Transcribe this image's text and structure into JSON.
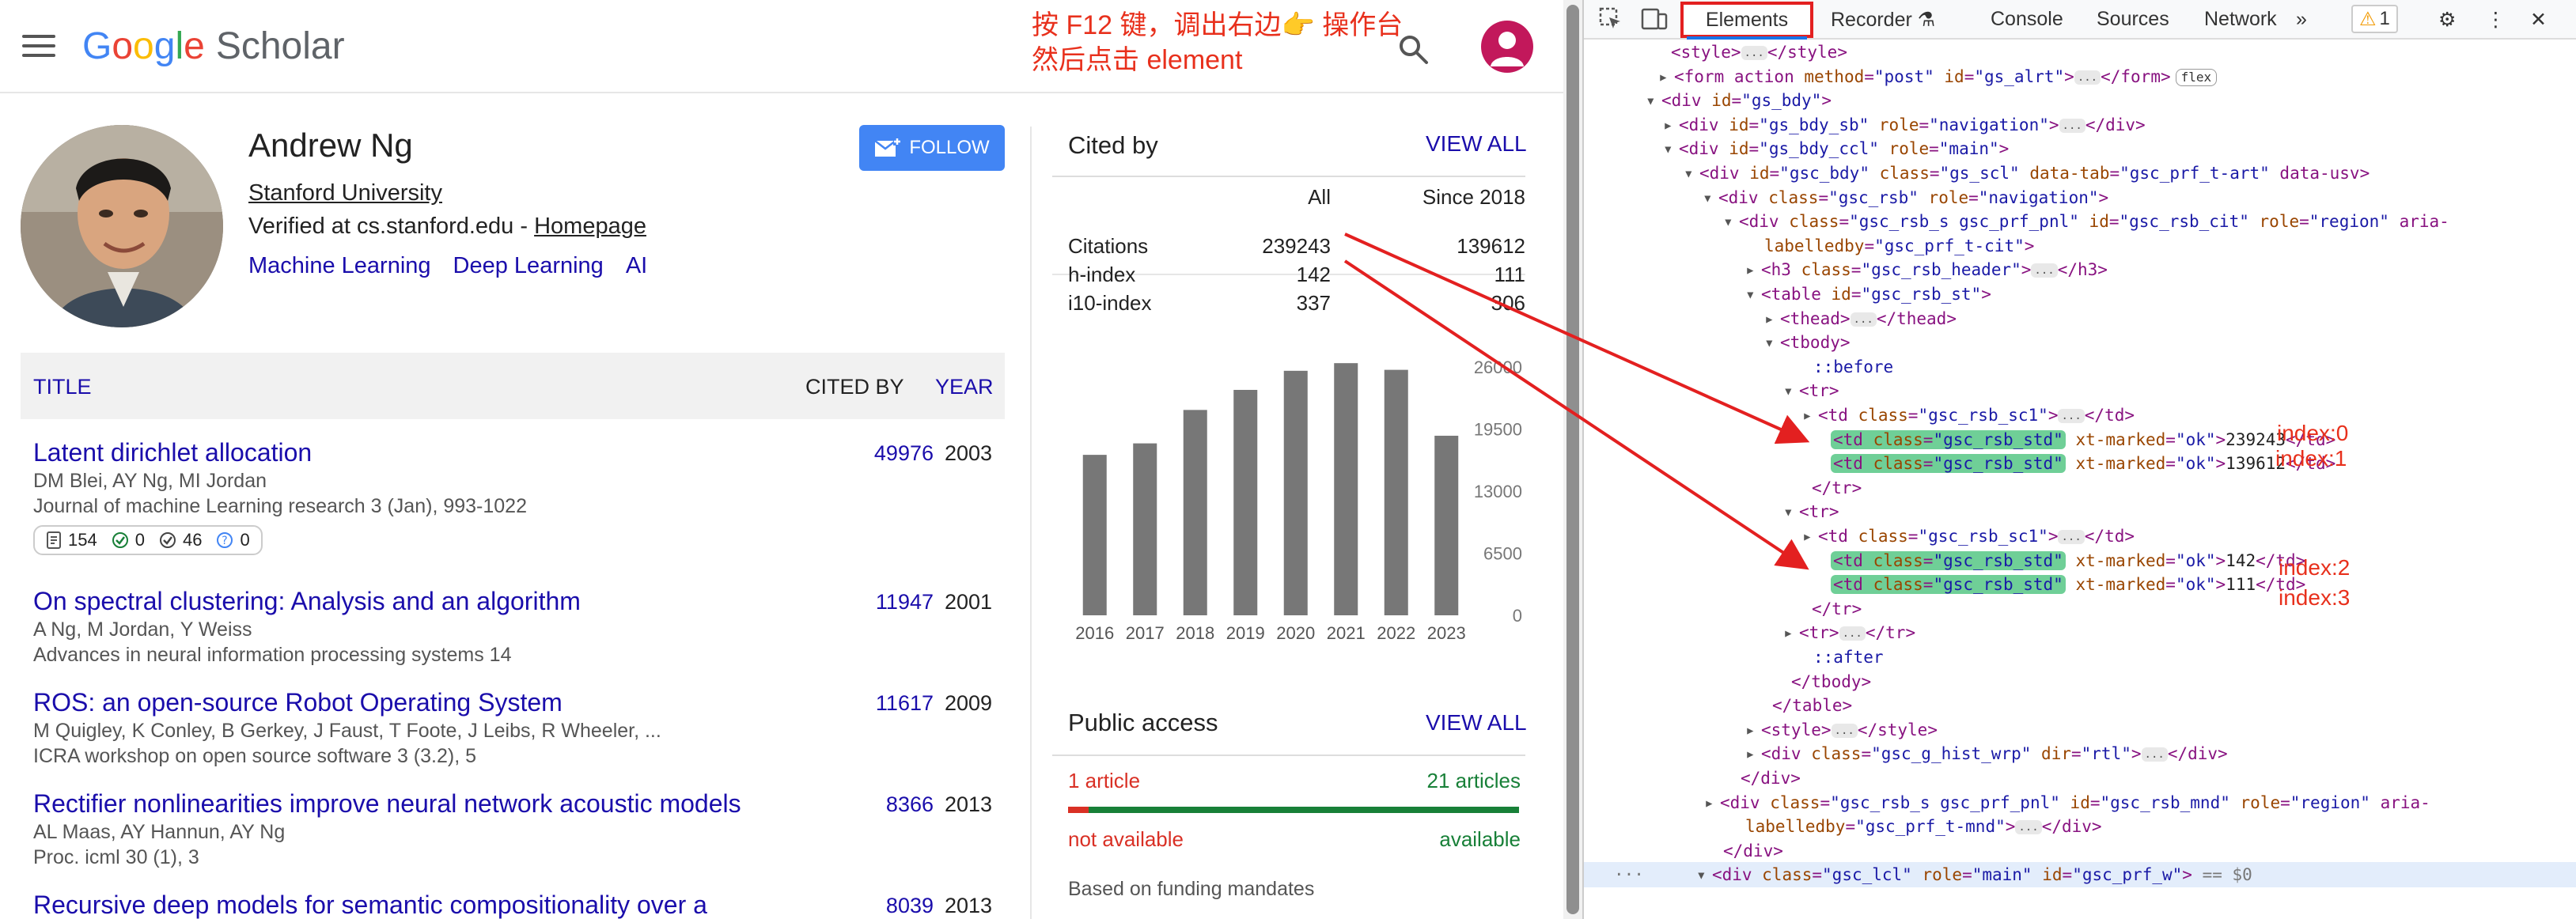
{
  "header": {
    "logo_google": [
      "G",
      "o",
      "o",
      "g",
      "l",
      "e"
    ],
    "logo_scholar": "Scholar",
    "note_line1": "按 F12 键，调出右边👉 操作台",
    "note_line2": "然后点击 element"
  },
  "profile": {
    "name": "Andrew Ng",
    "affiliation": "Stanford University",
    "verified": "Verified at cs.stanford.edu - ",
    "homepage": "Homepage",
    "interests": [
      "Machine Learning",
      "Deep Learning",
      "AI"
    ],
    "follow_label": "FOLLOW"
  },
  "articles": {
    "col_title": "TITLE",
    "col_cited": "CITED BY",
    "col_year": "YEAR",
    "items": [
      {
        "title": "Latent dirichlet allocation",
        "authors": "DM Blei, AY Ng, MI Jordan",
        "venue": "Journal of machine Learning research 3 (Jan), 993-1022",
        "cited": "49976",
        "year": "2003"
      },
      {
        "title": "On spectral clustering: Analysis and an algorithm",
        "authors": "A Ng, M Jordan, Y Weiss",
        "venue": "Advances in neural information processing systems 14",
        "cited": "11947",
        "year": "2001"
      },
      {
        "title": "ROS: an open-source Robot Operating System",
        "authors": "M Quigley, K Conley, B Gerkey, J Faust, T Foote, J Leibs, R Wheeler, ...",
        "venue": "ICRA workshop on open source software 3 (3.2), 5",
        "cited": "11617",
        "year": "2009"
      },
      {
        "title": "Rectifier nonlinearities improve neural network acoustic models",
        "authors": "AL Maas, AY Hannun, AY Ng",
        "venue": "Proc. icml 30 (1), 3",
        "cited": "8366",
        "year": "2013"
      },
      {
        "title": "Recursive deep models for semantic compositionality over a",
        "authors": "",
        "venue": "",
        "cited": "8039",
        "year": "2013"
      }
    ],
    "metrics": {
      "versions": "154",
      "free": "0",
      "checked": "46",
      "unknown": "0"
    }
  },
  "cited_by": {
    "title": "Cited by",
    "view_all": "VIEW ALL",
    "col_all": "All",
    "col_since": "Since 2018",
    "rows": [
      {
        "label": "Citations",
        "all": "239243",
        "since": "139612"
      },
      {
        "label": "h-index",
        "all": "142",
        "since": "111"
      },
      {
        "label": "i10-index",
        "all": "337",
        "since": "306"
      }
    ]
  },
  "chart_data": {
    "type": "bar",
    "categories": [
      "2016",
      "2017",
      "2018",
      "2019",
      "2020",
      "2021",
      "2022",
      "2023"
    ],
    "values": [
      16800,
      18000,
      21500,
      23600,
      25600,
      26400,
      25700,
      18800
    ],
    "ylim": [
      0,
      26000
    ],
    "yticks": [
      "26000",
      "19500",
      "13000",
      "6500",
      "0"
    ],
    "bar_color": "#777777"
  },
  "public_access": {
    "title": "Public access",
    "view_all": "VIEW ALL",
    "left_count": "1 article",
    "right_count": "21 articles",
    "fill_fraction": 0.045,
    "left_label": "not available",
    "right_label": "available",
    "footer": "Based on funding mandates"
  },
  "devtools": {
    "tabs": [
      "Elements",
      "Recorder",
      "Console",
      "Sources",
      "Network"
    ],
    "warn_count": "1",
    "index_labels": [
      "index:0",
      "index:1",
      "index:2",
      "index:3"
    ],
    "lines": [
      {
        "t": "<style>",
        "e": "...",
        "c": "</style>"
      },
      {
        "t": "<form action method=\"post\" id=\"gs_alrt\">",
        "e": "...",
        "c": "</form>",
        "p": "flex"
      },
      {
        "t": "<div id=\"gs_bdy\">"
      },
      {
        "t": "<div id=\"gs_bdy_sb\" role=\"navigation\">",
        "e": "...",
        "c": "</div>"
      },
      {
        "t": "<div id=\"gs_bdy_ccl\" role=\"main\">"
      },
      {
        "t": "<div id=\"gsc_bdy\" class=\"gs_scl\" data-tab=\"gsc_prf_t-art\" data-usv>"
      },
      {
        "t": "<div class=\"gsc_rsb\" role=\"navigation\">"
      },
      {
        "t": "<div class=\"gsc_rsb_s gsc_prf_pnl\" id=\"gsc_rsb_cit\" role=\"region\" aria-"
      },
      {
        "t": "labelledby=\"gsc_prf_t-cit\">"
      },
      {
        "t": "<h3 class=\"gsc_rsb_header\">",
        "e": "...",
        "c": "</h3>"
      },
      {
        "t": "<table id=\"gsc_rsb_st\">"
      },
      {
        "t": "<thead>",
        "e": "...",
        "c": "</thead>"
      },
      {
        "t": "<tbody>"
      },
      {
        "t": "::before"
      },
      {
        "t": "<tr>"
      },
      {
        "t": "<td class=\"gsc_rsb_sc1\">",
        "e": "...",
        "c": "</td>"
      },
      {
        "t": "<td class=\"gsc_rsb_std\"",
        "x": " xt-marked=\"ok\">",
        "v": "239243",
        "c": "</td>"
      },
      {
        "t": "<td class=\"gsc_rsb_std\"",
        "x": " xt-marked=\"ok\">",
        "v": "139612",
        "c": "</td>"
      },
      {
        "t": "</tr>"
      },
      {
        "t": "<tr>"
      },
      {
        "t": "<td class=\"gsc_rsb_sc1\">",
        "e": "...",
        "c": "</td>"
      },
      {
        "t": "<td class=\"gsc_rsb_std\"",
        "x": " xt-marked=\"ok\">",
        "v": "142",
        "c": "</td>"
      },
      {
        "t": "<td class=\"gsc_rsb_std\"",
        "x": " xt-marked=\"ok\">",
        "v": "111",
        "c": "</td>"
      },
      {
        "t": "</tr>"
      },
      {
        "t": "<tr>",
        "e": "...",
        "c": "</tr>"
      },
      {
        "t": "::after"
      },
      {
        "t": "</tbody>"
      },
      {
        "t": "</table>"
      },
      {
        "t": "<style>",
        "e": "...",
        "c": "</style>"
      },
      {
        "t": "<div class=\"gsc_g_hist_wrp\" dir=\"rtl\">",
        "e": "...",
        "c": "</div>"
      },
      {
        "t": "</div>"
      },
      {
        "t": "<div class=\"gsc_rsb_s gsc_prf_pnl\" id=\"gsc_rsb_mnd\" role=\"region\" aria-"
      },
      {
        "t": "labelledby=\"gsc_prf_t-mnd\">",
        "e": "...",
        "c": "</div>"
      },
      {
        "t": "</div>"
      },
      {
        "t": "<div class=\"gsc_lcl\" role=\"main\" id=\"gsc_prf_w\">",
        "c": " == $0"
      }
    ]
  }
}
